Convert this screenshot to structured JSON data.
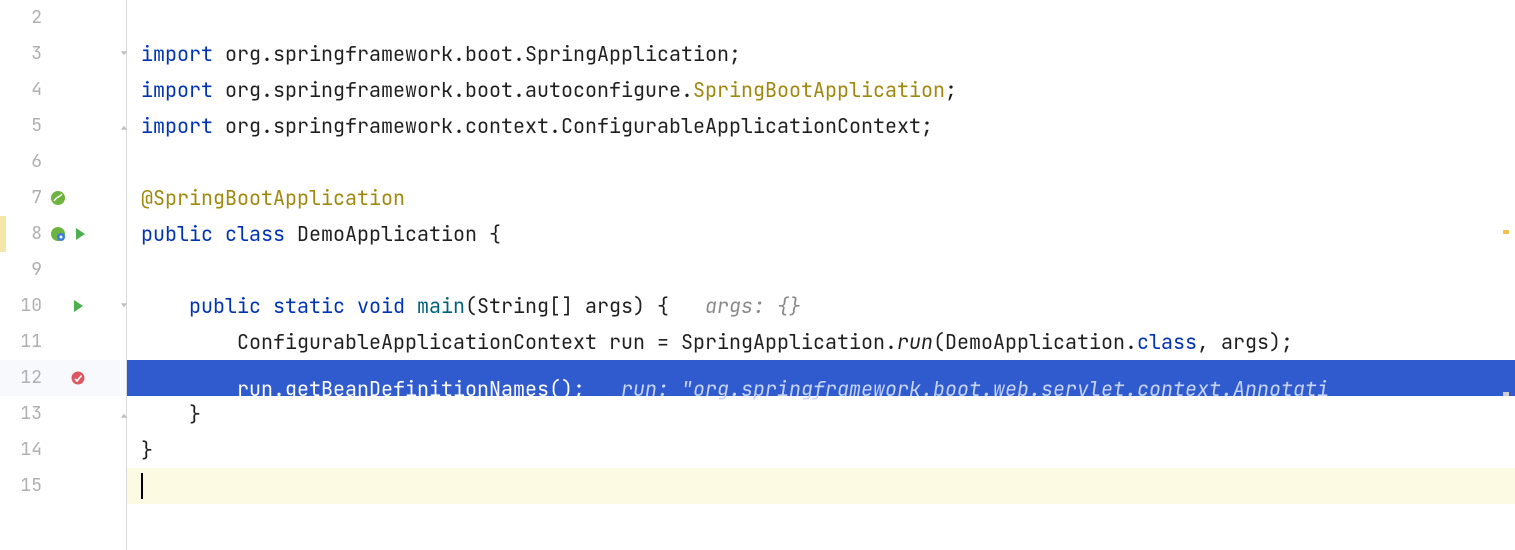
{
  "gutter": {
    "lines": [
      "2",
      "3",
      "4",
      "5",
      "6",
      "7",
      "8",
      "9",
      "10",
      "11",
      "12",
      "13",
      "14",
      "15"
    ]
  },
  "code": {
    "import_kw": "import",
    "import1_pkg": " org.springframework.boot.SpringApplication;",
    "import2_pkg1": " org.springframework.boot.autoconfigure.",
    "import2_cls": "SpringBootApplication",
    "import2_end": ";",
    "import3_pkg": " org.springframework.context.ConfigurableApplicationContext;",
    "annotation": "@SpringBootApplication",
    "public_kw": "public",
    "class_kw": "class",
    "classname": "DemoApplication",
    "lbrace": "{",
    "rbrace": "}",
    "static_kw": "static",
    "void_kw": "void",
    "main_name": "main",
    "main_params": "(String[] args) {",
    "args_hint": "args: {}",
    "line11_a": "ConfigurableApplicationContext run = SpringApplication.",
    "line11_run": "run",
    "line11_b": "(DemoApplication.",
    "class_lit": "class",
    "line11_c": ", args);",
    "line12_code": "run.getBeanDefinitionNames();",
    "line12_hint_label": "run:",
    "line12_hint_val": "\"org.springframework.boot.web.servlet.context.Annotati"
  }
}
